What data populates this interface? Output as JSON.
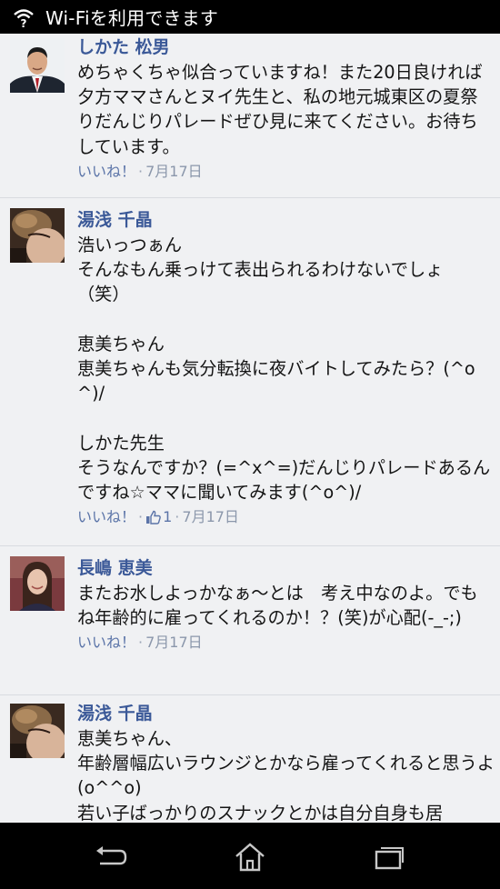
{
  "status_bar": {
    "text": "Wi-Fiを利用できます",
    "icon": "wifi-question-icon"
  },
  "comments": [
    {
      "author": "しかた 松男",
      "avatar": "man-in-suit-photo",
      "text": "めちゃくちゃ似合っていますね！また20日良ければ夕方ママさんとヌイ先生と、私の地元城東区の夏祭りだんじりパレードぜひ見に来てください。お待ちしています。",
      "like_label": "いいね！",
      "likes": "",
      "date": "7月17日"
    },
    {
      "author": "湯浅 千晶",
      "avatar": "woman-hair-updo-photo",
      "text": "浩いっつぁん\nそんなもん乗っけて表出られるわけないでしょ（笑）\n\n恵美ちゃん\n恵美ちゃんも気分転換に夜バイトしてみたら？(^o^)/\n\nしかた先生\nそうなんですか？(=^x^=)だんじりパレードあるんですね☆ママに聞いてみます(^o^)/",
      "like_label": "いいね！",
      "likes": "1",
      "date": "7月17日"
    },
    {
      "author": "長嶋 恵美",
      "avatar": "woman-smiling-photo",
      "text": "またお水しよっかなぁ～とは　考え中なのよ。でもね年齢的に雇ってくれるのか！？(笑)が心配(-_-;)",
      "like_label": "いいね！",
      "likes": "",
      "date": "7月17日"
    },
    {
      "author": "湯浅 千晶",
      "avatar": "woman-hair-updo-photo",
      "text": "恵美ちゃん、\n年齢層幅広いラウンジとかなら雇ってくれると思うよ(o^^o)\n若い子ばっかりのスナックとかは自分自身も居",
      "like_label": "",
      "likes": "",
      "date": ""
    }
  ],
  "nav": {
    "back": "back-icon",
    "home": "home-icon",
    "recents": "recent-apps-icon"
  },
  "colors": {
    "author": "#3b5998",
    "background": "#f0f1f3",
    "meta": "#8b97ab"
  }
}
